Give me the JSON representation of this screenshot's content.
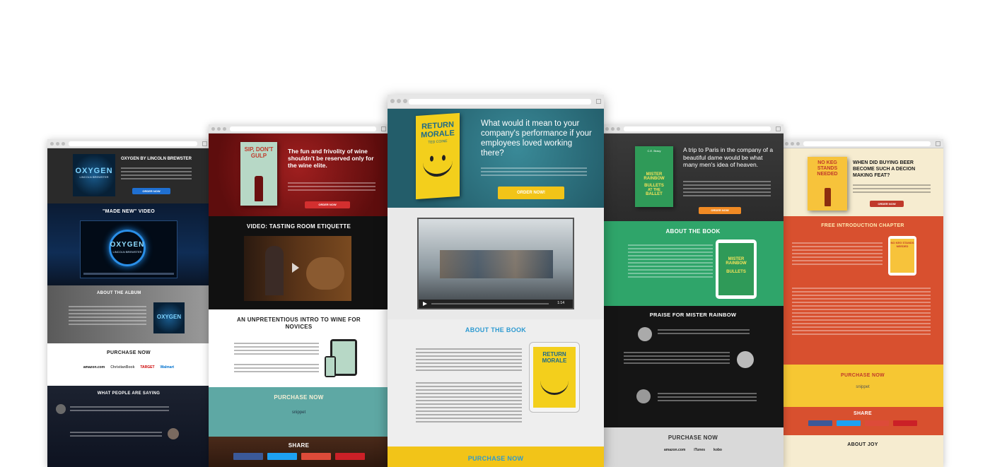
{
  "colors": {
    "red": "#c0392b",
    "orange": "#f08a24",
    "teal": "#2e6f7a",
    "yellow": "#f2c418",
    "green": "#33a06f",
    "dark": "#1c1c1c",
    "facebook": "#3b5998",
    "twitter": "#1da1f2",
    "google": "#dd4b39",
    "pinterest": "#cb2027"
  },
  "oxygen": {
    "album_title": "OXYGEN",
    "artist_label": "LINCOLN BREWSTER",
    "hero_heading": "OXYGEN BY LINCOLN BREWSTER",
    "hero_button": "ORDER NOW",
    "video_heading": "\"MADE NEW\" VIDEO",
    "about_heading": "ABOUT THE ALBUM",
    "purchase_heading": "PURCHASE NOW",
    "retailers": [
      "amazon.com",
      "ChristianBook",
      "TARGET",
      "Walmart"
    ],
    "people_heading": "WHAT PEOPLE ARE SAYING"
  },
  "wine": {
    "book_title": "SIP, DON'T GULP",
    "hero_heading": "The fun and frivolity of wine shouldn't be reserved only for the wine elite.",
    "hero_button": "ORDER NOW",
    "video_heading": "VIDEO: TASTING ROOM ETIQUETTE",
    "intro_heading": "AN UNPRETENTIOUS INTRO TO WINE FOR NOVICES",
    "purchase_heading": "PURCHASE NOW",
    "snippet_label": "snippet",
    "share_heading": "SHARE"
  },
  "morale": {
    "book_title_1": "RETURN",
    "book_title_2": "MORALE",
    "book_subtitle": "TED COINE",
    "hero_heading": "What would it mean to your company's performance if your employees loved working there?",
    "hero_button": "ORDER NOW!",
    "video_time": "1:14",
    "about_heading": "ABOUT THE BOOK",
    "purchase_heading": "PURCHASE NOW"
  },
  "rainbow": {
    "book_title_1": "MISTER",
    "book_title_2": "RAINBOW",
    "book_title_3": "BULLETS",
    "book_title_4": "AT THE",
    "book_title_5": "BALLET",
    "book_author": "C.E. Bracy",
    "hero_heading": "A trip to Paris in the company of a beautiful dame would be what many men's idea of heaven.",
    "hero_button": "ORDER NOW",
    "about_heading": "ABOUT THE BOOK",
    "praise_heading": "PRAISE FOR MISTER RAINBOW",
    "purchase_heading": "PURCHASE NOW",
    "retailers": [
      "amazon.com",
      "iTunes",
      "kobo"
    ]
  },
  "keg": {
    "book_title": "NO KEG STANDS NEEDED",
    "hero_heading": "WHEN DID BUYING BEER BECOME SUCH A DECION MAKING FEAT?",
    "hero_button": "ORDER NOW",
    "chapter_heading": "FREE INTRODUCTION CHAPTER",
    "purchase_heading": "PURCHASE NOW",
    "snippet_label": "snippet",
    "share_heading": "SHARE",
    "about_heading": "ABOUT JOY"
  }
}
